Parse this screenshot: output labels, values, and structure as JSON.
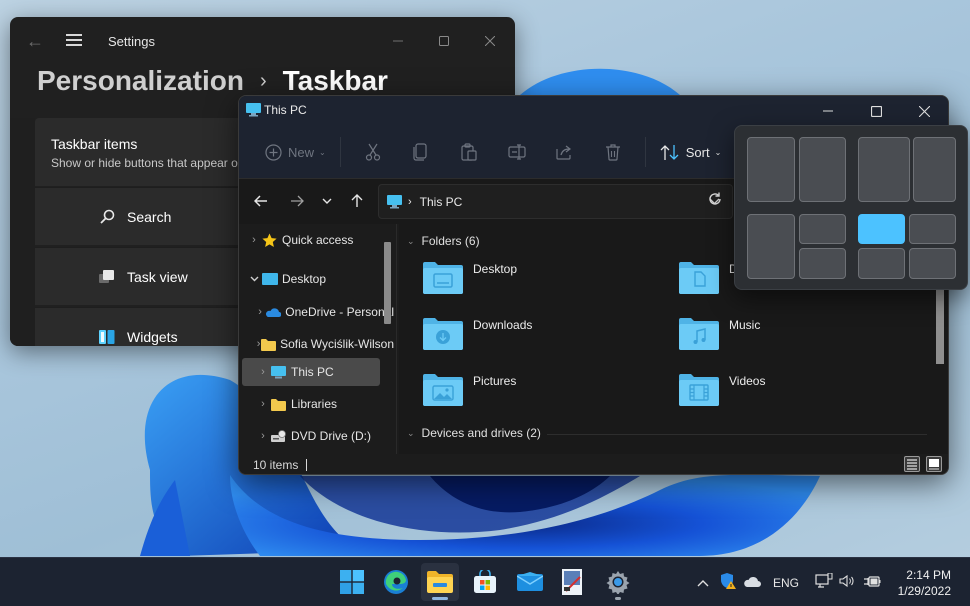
{
  "settings": {
    "app_title": "Settings",
    "breadcrumb": {
      "parent": "Personalization",
      "separator": "›",
      "current": "Taskbar"
    },
    "card": {
      "title": "Taskbar items",
      "subtitle": "Show or hide buttons that appear on the taskbar"
    },
    "options": [
      {
        "label": "Search",
        "icon": "search-icon"
      },
      {
        "label": "Task view",
        "icon": "task-view-icon"
      },
      {
        "label": "Widgets",
        "icon": "widgets-icon"
      }
    ]
  },
  "explorer": {
    "title": "This PC",
    "commands": {
      "new_label": "New",
      "sort_label": "Sort",
      "icons": [
        "cut-icon",
        "copy-icon",
        "paste-icon",
        "rename-icon",
        "share-icon",
        "delete-icon"
      ]
    },
    "address": {
      "location": "This PC"
    },
    "tree": [
      {
        "label": "Quick access",
        "expander": "›",
        "icon": "star-icon"
      },
      {
        "label": "Desktop",
        "expander": "⌄",
        "icon": "desktop-icon"
      },
      {
        "label": "OneDrive - Personal",
        "expander": "›",
        "icon": "onedrive-icon"
      },
      {
        "label": "Sofia Wyciślik-Wilson",
        "expander": "›",
        "icon": "folder-icon"
      },
      {
        "label": "This PC",
        "expander": "›",
        "icon": "pc-icon",
        "selected": true
      },
      {
        "label": "Libraries",
        "expander": "›",
        "icon": "folder-icon"
      },
      {
        "label": "DVD Drive (D:)",
        "expander": "›",
        "icon": "dvd-drive-icon"
      }
    ],
    "groups": {
      "folders": "Folders (6)",
      "devices": "Devices and drives (2)"
    },
    "folders": [
      {
        "label": "Desktop",
        "icon": "desktop-folder-icon"
      },
      {
        "label": "Documents",
        "icon": "documents-folder-icon"
      },
      {
        "label": "Downloads",
        "icon": "downloads-folder-icon"
      },
      {
        "label": "Music",
        "icon": "music-folder-icon"
      },
      {
        "label": "Pictures",
        "icon": "pictures-folder-icon"
      },
      {
        "label": "Videos",
        "icon": "videos-folder-icon"
      }
    ],
    "status": {
      "item_count": "10 items"
    }
  },
  "snap_layouts": {
    "active_layout": 4,
    "active_zone": "top-left"
  },
  "taskbar": {
    "apps": [
      "Start",
      "Microsoft Edge",
      "File Explorer",
      "Microsoft Store",
      "Mail",
      "Paint",
      "Settings"
    ],
    "active_app": "File Explorer",
    "tray": {
      "language": "ENG",
      "time": "2:14 PM",
      "date": "1/29/2022"
    }
  },
  "colors": {
    "accent": "#4cc2ff",
    "folder_blue": "#66c6f4",
    "taskbar_bg": "#1c2331"
  }
}
